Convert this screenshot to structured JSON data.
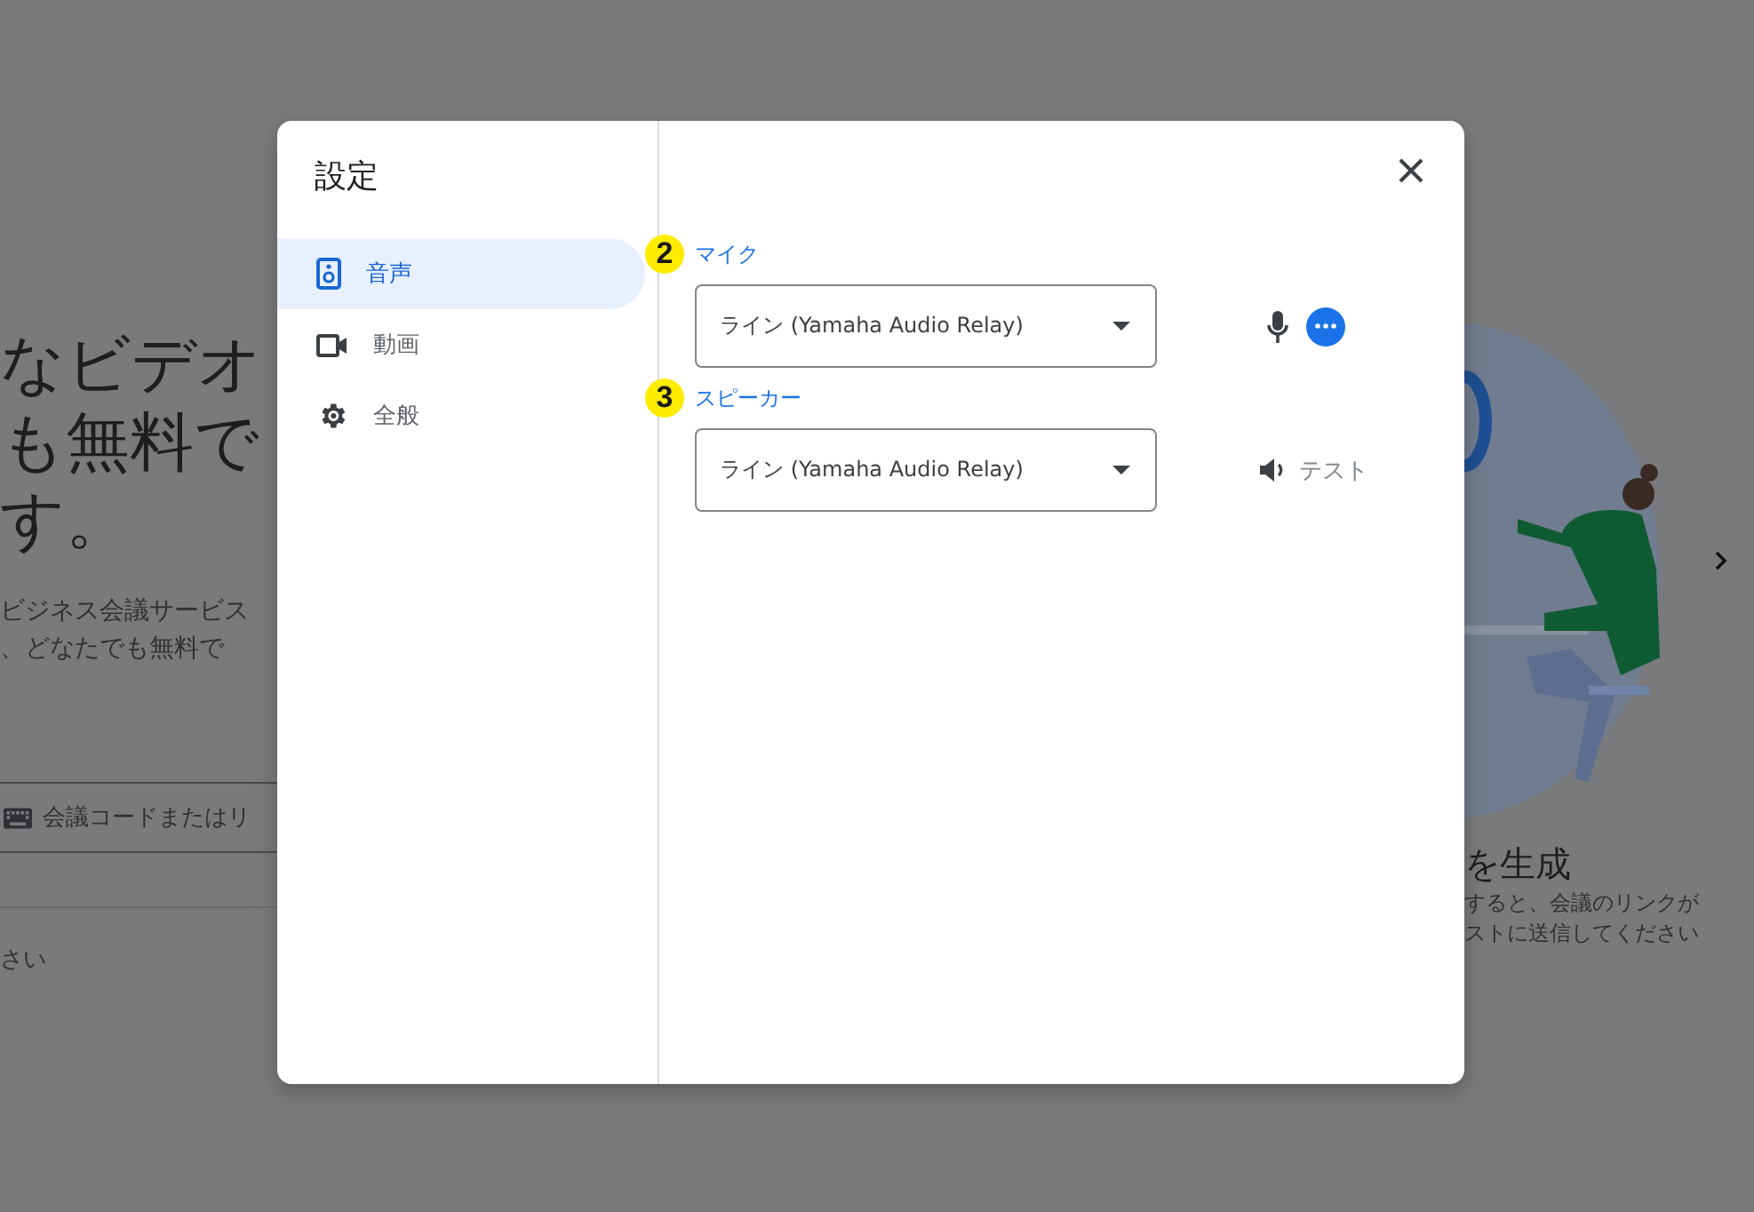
{
  "background": {
    "headline": [
      "なビデオ",
      "も無料で",
      "す。"
    ],
    "description": [
      "ビジネス会議サービス",
      "、どなたでも無料で"
    ],
    "meeting_code_field": {
      "placeholder": "会議コードまたはリ"
    },
    "note": "さい",
    "feature_title": "を生成",
    "feature_text": [
      "すると、会議のリンクが",
      "ストに送信してください"
    ]
  },
  "dialog": {
    "title": "設定",
    "nav": [
      {
        "label": "音声",
        "kind": "audio",
        "selected": true
      },
      {
        "label": "動画",
        "kind": "video",
        "selected": false
      },
      {
        "label": "全般",
        "kind": "general",
        "selected": false
      }
    ],
    "sections": [
      {
        "kind": "mic",
        "badge": "2",
        "label": "マイク",
        "value": "ライン (Yamaha Audio Relay)"
      },
      {
        "kind": "speaker",
        "badge": "3",
        "label": "スピーカー",
        "value": "ライン (Yamaha Audio Relay)",
        "action": "テスト"
      }
    ]
  }
}
